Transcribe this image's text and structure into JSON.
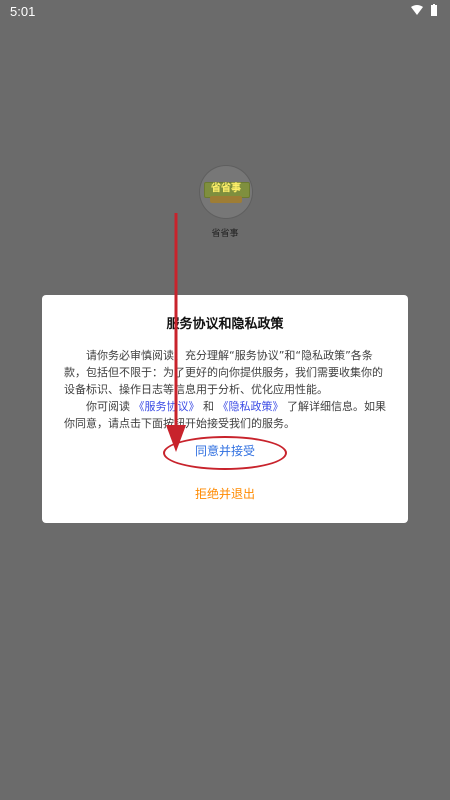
{
  "status_bar": {
    "time": "5:01"
  },
  "app": {
    "logo_text": "省省事",
    "name": "省省事"
  },
  "dialog": {
    "title": "服务协议和隐私政策",
    "body": {
      "p1": "请你务必审慎阅读、充分理解“服务协议”和“隐私政策”各条款，包括但不限于：为了更好的向你提供服务，我们需要收集你的设备标识、操作日志等信息用于分析、优化应用性能。",
      "p2_prefix": "你可阅读",
      "link_service": "《服务协议》",
      "p2_and": "和",
      "link_privacy": "《隐私政策》",
      "p2_suffix": "了解详细信息。如果你同意，请点击下面按钮开始接受我们的服务。"
    },
    "accept_label": "同意并接受",
    "reject_label": "拒绝并退出"
  },
  "colors": {
    "accent_blue": "#2f6fe0",
    "link_blue": "#3b4be5",
    "reject_orange": "#ff8a00",
    "annotation_red": "#c8232c"
  }
}
